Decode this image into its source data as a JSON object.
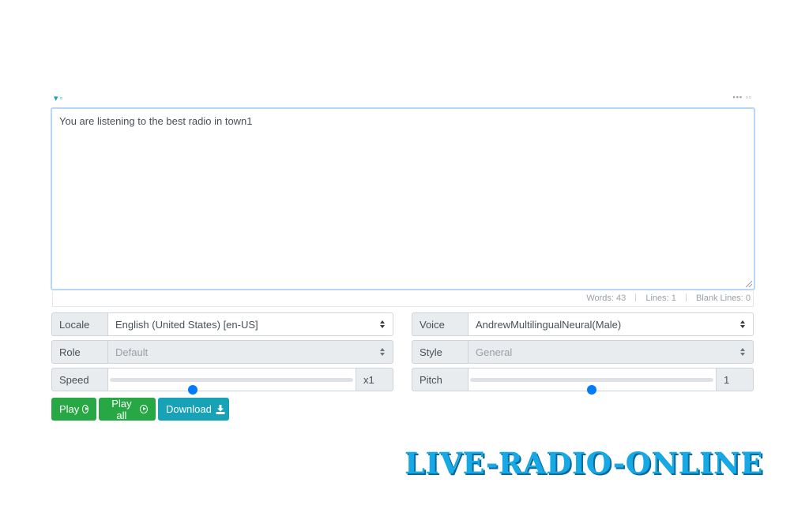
{
  "editor": {
    "text": "You are listening to the best radio in town1"
  },
  "stats": {
    "words_label": "Words:",
    "words_value": "43",
    "lines_label": "Lines:",
    "lines_value": "1",
    "blank_label": "Blank Lines:",
    "blank_value": "0"
  },
  "controls": {
    "locale": {
      "label": "Locale",
      "value": "English (United States) [en-US]"
    },
    "voice": {
      "label": "Voice",
      "value": "AndrewMultilingualNeural(Male)"
    },
    "role": {
      "label": "Role",
      "value": "Default"
    },
    "style": {
      "label": "Style",
      "value": "General"
    },
    "speed": {
      "label": "Speed",
      "value_text": "x1",
      "fraction": 0.34
    },
    "pitch": {
      "label": "Pitch",
      "value_text": "1",
      "fraction": 0.5
    }
  },
  "buttons": {
    "play": "Play",
    "play_all": "Play all",
    "download": "Download"
  },
  "watermark": "LIVE-RADIO-ONLINE",
  "colors": {
    "green": "#28a745",
    "teal": "#17a2b8",
    "slider": "#007bff",
    "watermark": "#17a9e6"
  }
}
